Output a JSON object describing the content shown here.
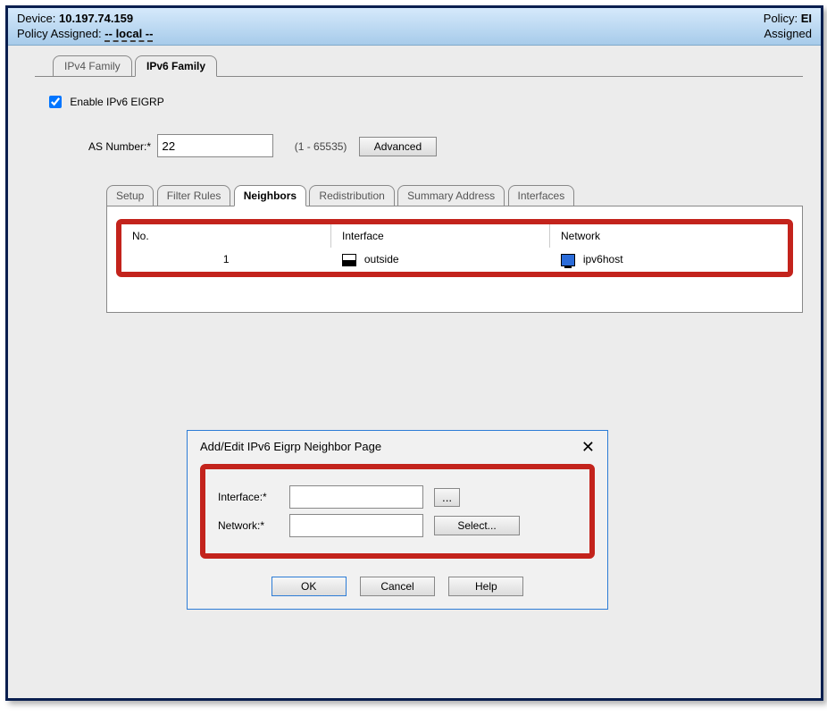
{
  "header": {
    "device_label": "Device:",
    "device_value": "10.197.74.159",
    "policy_assigned_label": "Policy Assigned:",
    "policy_assigned_value": "-- local --",
    "policy_right_label": "Policy:",
    "policy_right_value": "EI",
    "assigned_right_label": "Assigned"
  },
  "family_tabs": {
    "ipv4": "IPv4 Family",
    "ipv6": "IPv6 Family"
  },
  "enable_checkbox": {
    "label": "Enable IPv6 EIGRP",
    "checked": true
  },
  "as_row": {
    "label": "AS Number:*",
    "value": "22",
    "hint": "(1 - 65535)",
    "advanced_label": "Advanced"
  },
  "inner_tabs": {
    "setup": "Setup",
    "filter_rules": "Filter Rules",
    "neighbors": "Neighbors",
    "redistribution": "Redistribution",
    "summary_address": "Summary Address",
    "interfaces": "Interfaces",
    "active": "neighbors"
  },
  "neighbors_table": {
    "cols": {
      "no": "No.",
      "interface": "Interface",
      "network": "Network"
    },
    "rows": [
      {
        "no": "1",
        "interface": "outside",
        "network": "ipv6host"
      }
    ]
  },
  "dialog": {
    "title": "Add/Edit IPv6 Eigrp Neighbor Page",
    "interface_label": "Interface:*",
    "interface_value": "",
    "browse_label": "...",
    "network_label": "Network:*",
    "network_value": "",
    "select_label": "Select...",
    "ok_label": "OK",
    "cancel_label": "Cancel",
    "help_label": "Help"
  }
}
